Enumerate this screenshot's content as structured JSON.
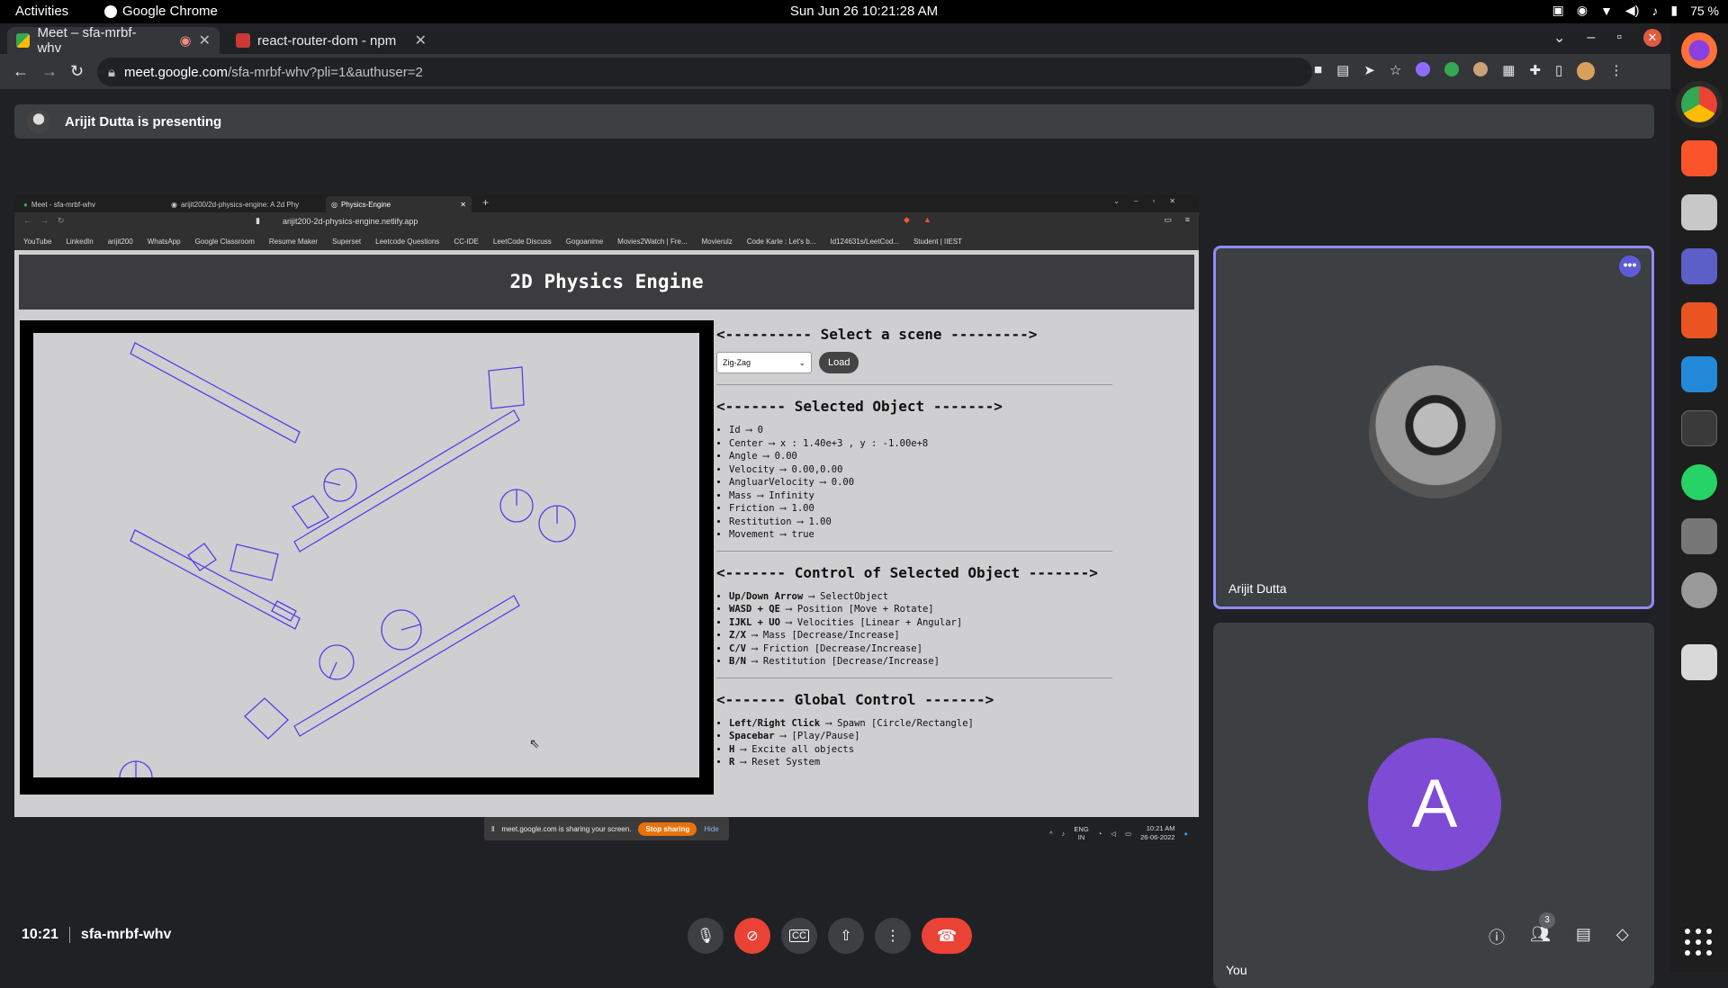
{
  "os": {
    "activities": "Activities",
    "app_name": "Google Chrome",
    "clock": "Sun Jun 26  10:21:28 AM",
    "battery": "75 %"
  },
  "browser": {
    "tabs": [
      {
        "title": "Meet – sfa-mrbf-whv",
        "active": true
      },
      {
        "title": "react-router-dom - npm",
        "active": false
      }
    ],
    "url_domain": "meet.google.com",
    "url_path": "/sfa-mrbf-whv?pli=1&authuser=2"
  },
  "meet": {
    "presenting_banner": "Arijit Dutta is presenting",
    "time": "10:21",
    "meeting_code": "sfa-mrbf-whv",
    "participants_count": "3",
    "tiles": [
      {
        "name": "Arijit Dutta",
        "menu_glyph": "•••"
      },
      {
        "name": "You",
        "initial": "A"
      }
    ]
  },
  "shared": {
    "tabs": [
      {
        "title": "Meet - sfa-mrbf-whv"
      },
      {
        "title": "arijit200/2d-physics-engine: A 2d Phy"
      },
      {
        "title": "Physics-Engine"
      }
    ],
    "url": "arijit200-2d-physics-engine.netlify.app",
    "bookmarks": [
      "YouTube",
      "LinkedIn",
      "arijit200",
      "WhatsApp",
      "Google Classroom",
      "Resume Maker",
      "Superset",
      "Leetcode Questions",
      "CC-IDE",
      "LeetCode Discuss",
      "Gogoanime",
      "Movies2Watch | Fre...",
      "Movierulz",
      "Code Karle : Let's b...",
      "Id124631s/LeetCod...",
      "Student | IIEST"
    ],
    "page_title": "2D Physics Engine",
    "scene_header": "<---------- Select a scene --------->",
    "scene_value": "Zig-Zag",
    "load_label": "Load",
    "selected_header": "<------- Selected Object ------->",
    "selected_items": [
      "Id ⟶ 0",
      "Center ⟶ x : 1.40e+3 , y : -1.00e+8",
      "Angle ⟶ 0.00",
      "Velocity ⟶ 0.00,0.00",
      "AngluarVelocity ⟶ 0.00",
      "Mass ⟶ Infinity",
      "Friction ⟶ 1.00",
      "Restitution ⟶ 1.00",
      "Movement ⟶ true"
    ],
    "control_header": "<------- Control of Selected Object ------->",
    "control_items": [
      {
        "key": "Up/Down Arrow",
        "desc": " ⟶ SelectObject"
      },
      {
        "key": "WASD + QE",
        "desc": " ⟶ Position [Move + Rotate]"
      },
      {
        "key": "IJKL + UO",
        "desc": " ⟶ Velocities [Linear + Angular]"
      },
      {
        "key": "Z/X",
        "desc": " ⟶ Mass [Decrease/Increase]"
      },
      {
        "key": "C/V",
        "desc": " ⟶ Friction [Decrease/Increase]"
      },
      {
        "key": "B/N",
        "desc": " ⟶ Restitution [Decrease/Increase]"
      }
    ],
    "global_header": "<------- Global Control ------->",
    "global_items": [
      {
        "key": "Left/Right Click",
        "desc": " ⟶ Spawn [Circle/Rectangle]"
      },
      {
        "key": "Spacebar",
        "desc": " ⟶ [Play/Pause]"
      },
      {
        "key": "H",
        "desc": " ⟶ Excite all objects"
      },
      {
        "key": "R",
        "desc": " ⟶ Reset System"
      }
    ],
    "sharing_text": "meet.google.com is sharing your screen.",
    "stop_sharing": "Stop sharing",
    "hide": "Hide",
    "win_lang": "ENG",
    "win_region": "IN",
    "win_time": "10:21 AM",
    "win_date": "26-06-2022"
  },
  "colors": {
    "accent_purple": "#7e4bd4",
    "end_call_red": "#ea4335",
    "shape_stroke": "#5a3ee6"
  }
}
